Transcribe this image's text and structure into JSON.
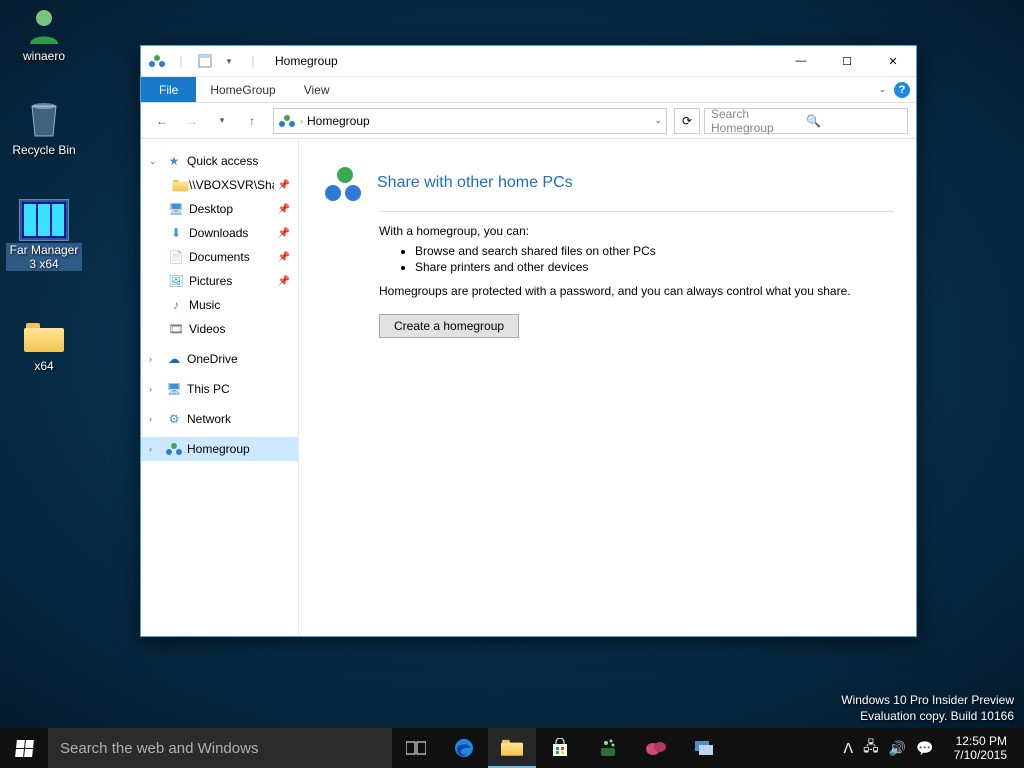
{
  "desktop": {
    "icons": [
      {
        "name": "winaero"
      },
      {
        "name": "Recycle Bin"
      },
      {
        "name": "Far Manager 3 x64"
      },
      {
        "name": "x64"
      }
    ]
  },
  "explorer": {
    "title": "Homegroup",
    "tabs": {
      "file": "File",
      "homegroup": "HomeGroup",
      "view": "View"
    },
    "address": {
      "crumb": "Homegroup"
    },
    "search": {
      "placeholder": "Search Homegroup"
    },
    "navpane": {
      "quick_access": "Quick access",
      "items": [
        {
          "label": "\\\\VBOXSVR\\Shared"
        },
        {
          "label": "Desktop"
        },
        {
          "label": "Downloads"
        },
        {
          "label": "Documents"
        },
        {
          "label": "Pictures"
        },
        {
          "label": "Music"
        },
        {
          "label": "Videos"
        }
      ],
      "onedrive": "OneDrive",
      "this_pc": "This PC",
      "network": "Network",
      "homegroup": "Homegroup"
    },
    "content": {
      "title": "Share with other home PCs",
      "intro": "With a homegroup, you can:",
      "bullets": [
        "Browse and search shared files on other PCs",
        "Share printers and other devices"
      ],
      "note": "Homegroups are protected with a password, and you can always control what you share.",
      "button": "Create a homegroup"
    }
  },
  "watermark": {
    "line1": "Windows 10 Pro Insider Preview",
    "line2": "Evaluation copy. Build 10166"
  },
  "taskbar": {
    "search_placeholder": "Search the web and Windows",
    "clock_time": "12:50 PM",
    "clock_date": "7/10/2015"
  }
}
